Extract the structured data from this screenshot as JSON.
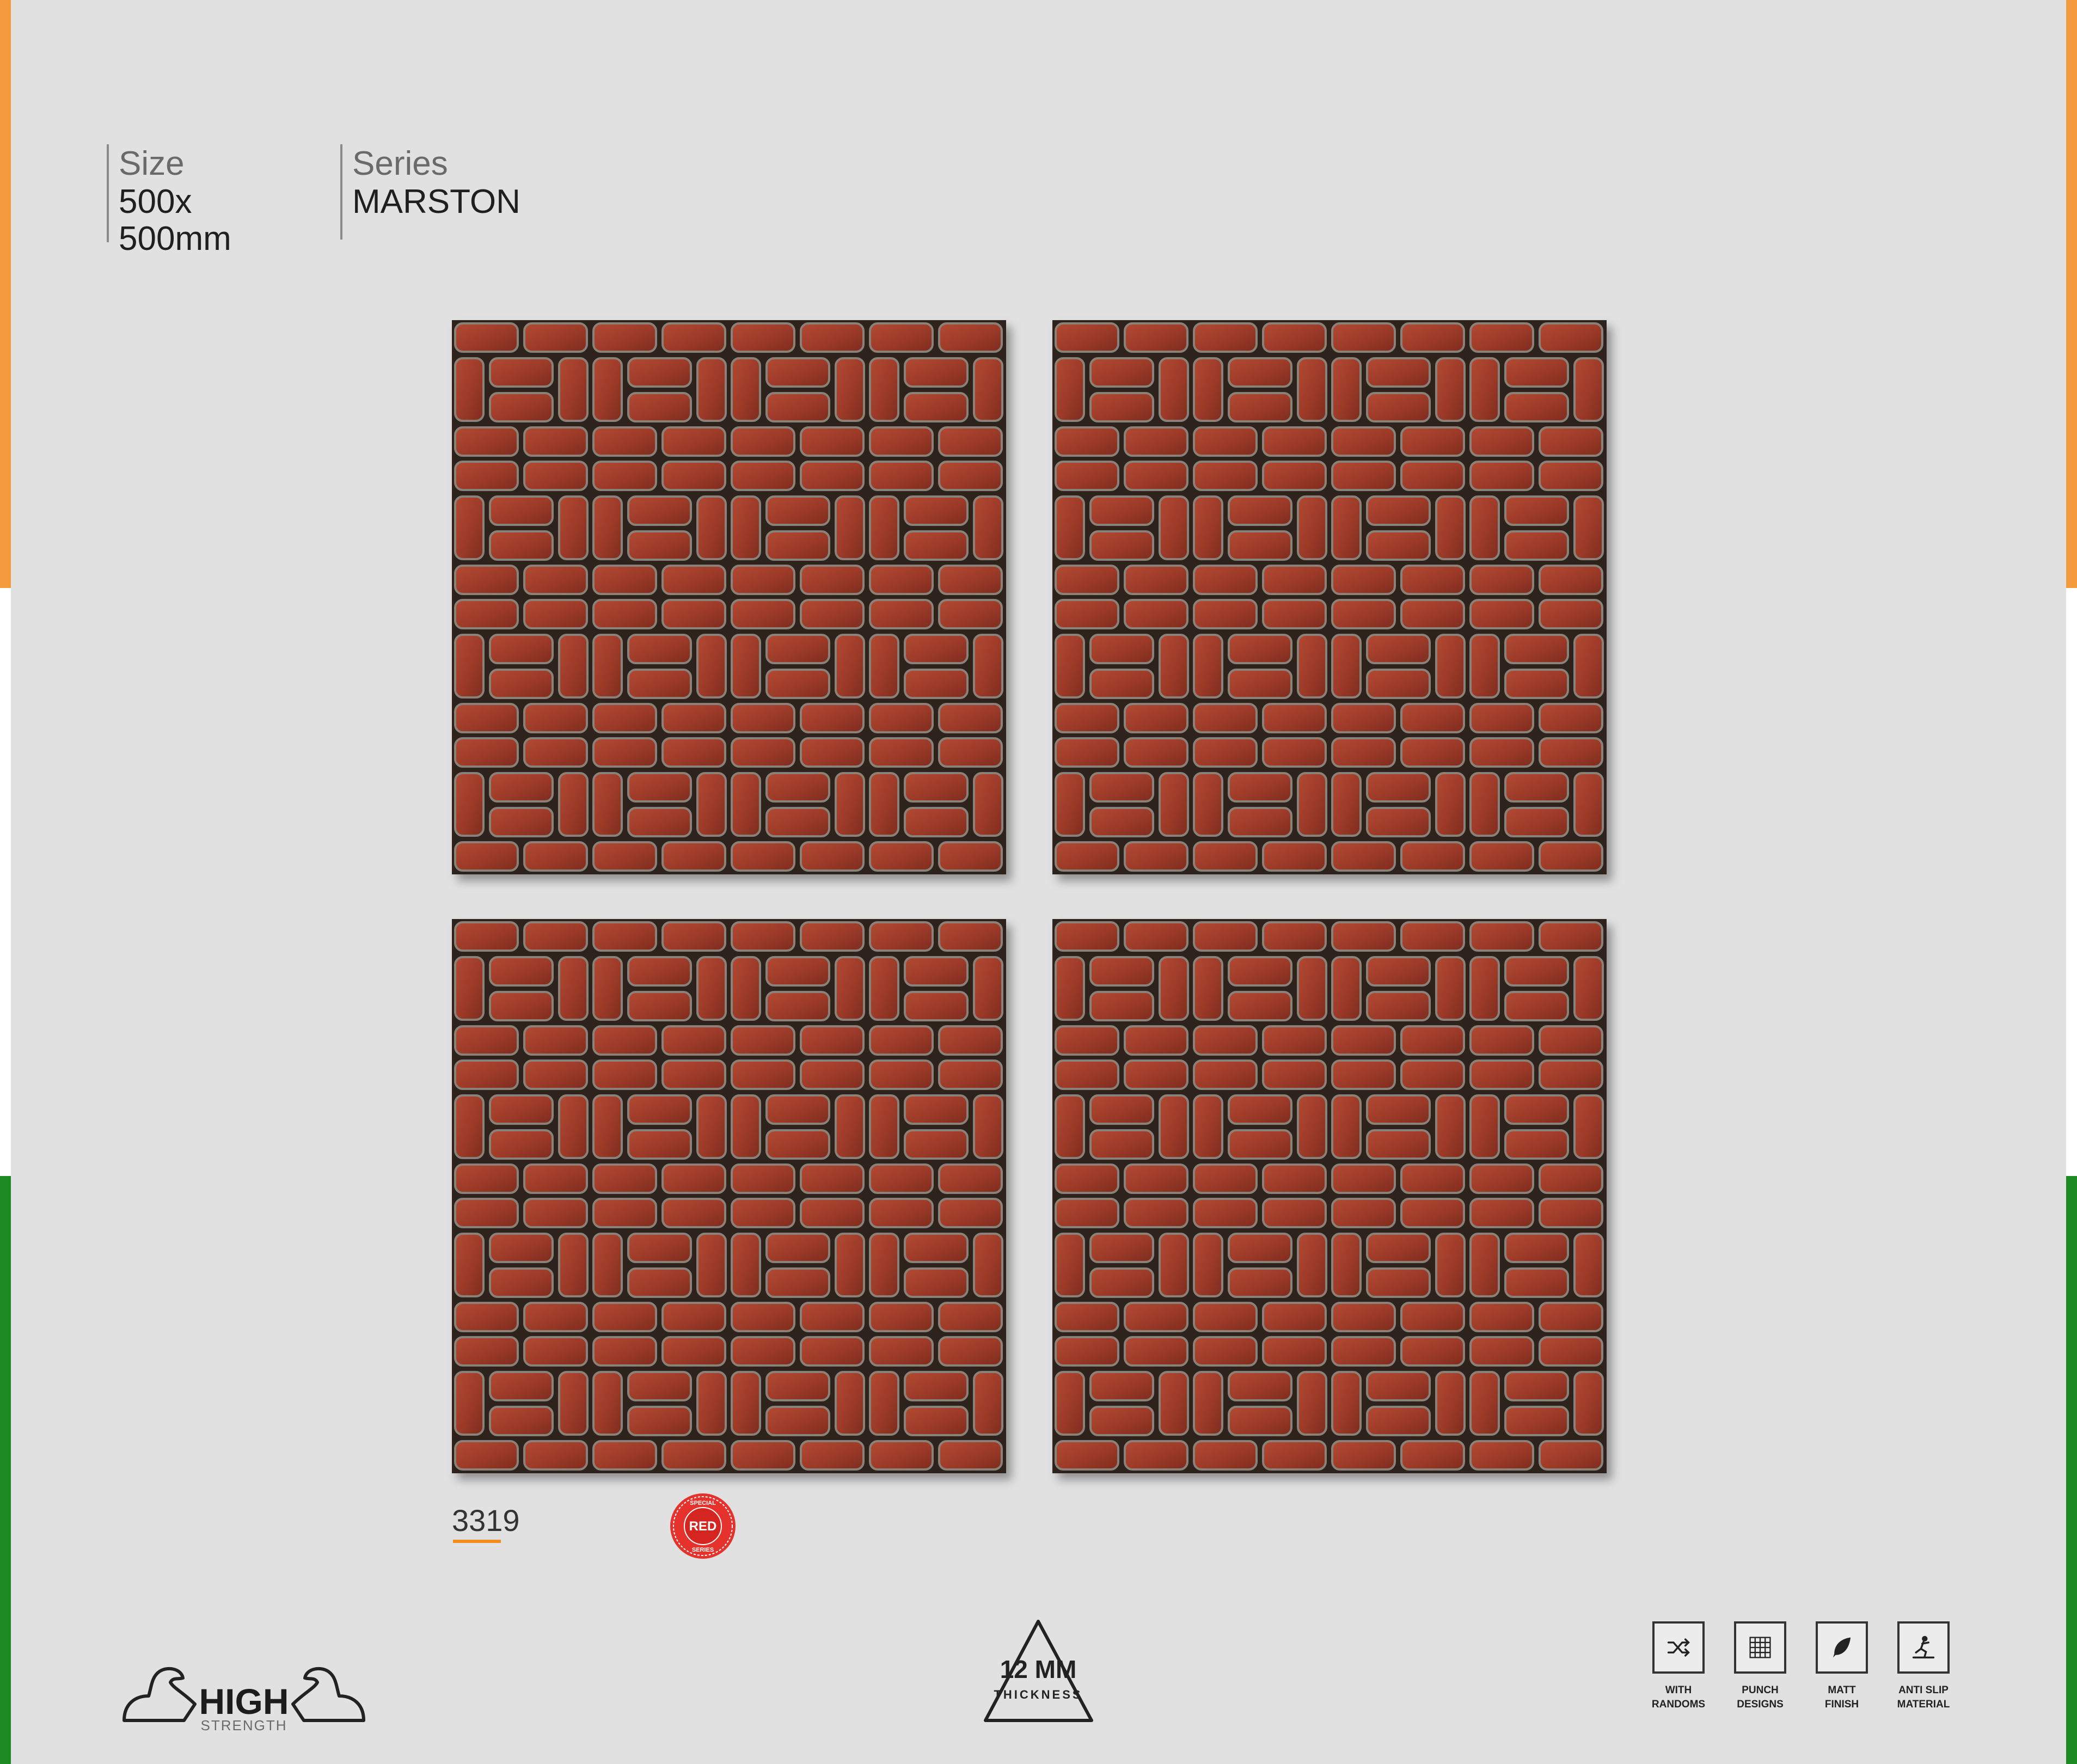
{
  "spec": {
    "size_label": "Size",
    "size_value": "500x\n500mm",
    "series_label": "Series",
    "series_value": "MARSTON"
  },
  "product": {
    "code": "3319",
    "badge": {
      "top_text": "SPECIAL",
      "main_text": "RED",
      "bottom_text": "SERIES",
      "color": "#e5322d"
    }
  },
  "logos": {
    "strength": {
      "line1": "HIGH",
      "line2": "STRENGTH"
    },
    "thickness": {
      "value": "12 MM",
      "label": "THICKNESS"
    }
  },
  "features": [
    {
      "icon": "shuffle-icon",
      "label": "WITH\nRANDOMS"
    },
    {
      "icon": "grid-icon",
      "label": "PUNCH\nDESIGNS"
    },
    {
      "icon": "feather-icon",
      "label": "MATT\nFINISH"
    },
    {
      "icon": "anti-slip-icon",
      "label": "ANTI SLIP\nMATERIAL"
    }
  ],
  "colors": {
    "flag_orange": "#f39a3c",
    "flag_white": "#ffffff",
    "flag_green": "#1b8a23",
    "brick": "#a3402c",
    "accent_underline": "#f28c1e"
  }
}
